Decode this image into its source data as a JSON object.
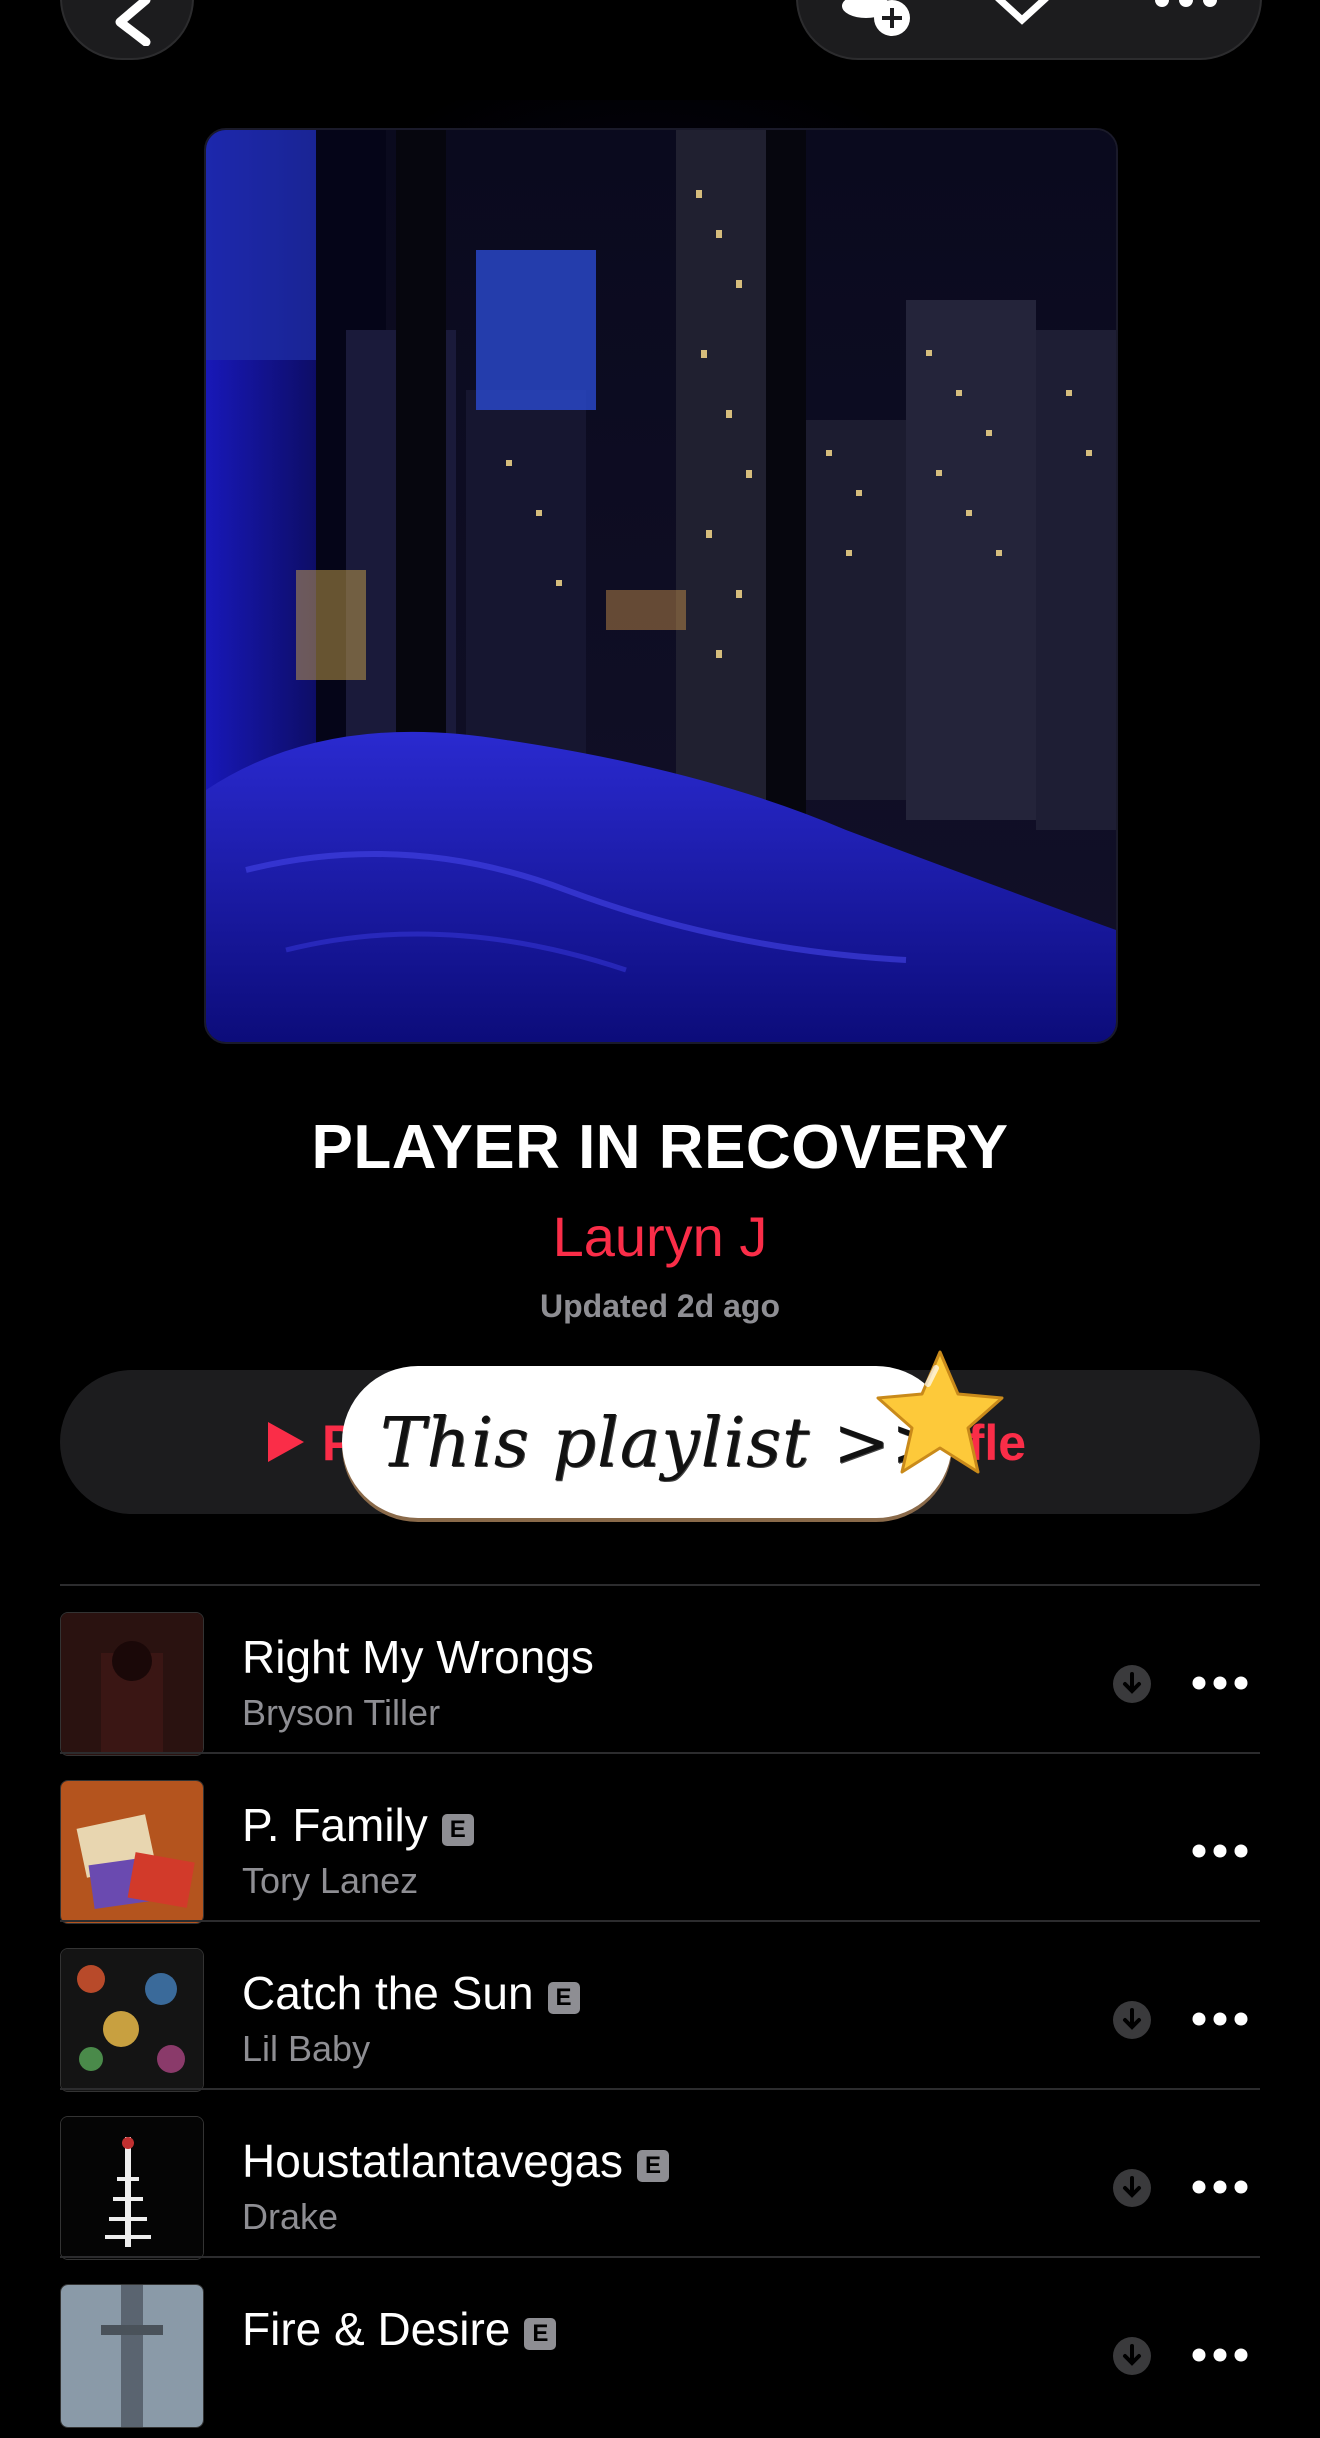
{
  "header": {
    "back_icon": "chevron-left-icon",
    "actions": [
      "add-person-icon",
      "download-icon",
      "more-icon"
    ]
  },
  "playlist": {
    "title": "PLAYER IN RECOVERY",
    "curator": "Lauryn J",
    "updated": "Updated 2d ago"
  },
  "actions": {
    "play_label": "P",
    "shuffle_label": "huffle"
  },
  "sticker": {
    "text": "This playlist >>",
    "icon": "star-icon"
  },
  "colors": {
    "accent": "#fa2d48",
    "secondary_text": "#8e8e93",
    "background": "#000000",
    "surface": "#1c1c1e"
  },
  "songs": [
    {
      "title": "Right My Wrongs",
      "artist": "Bryson Tiller",
      "explicit": false,
      "downloadable": true
    },
    {
      "title": "P. Family",
      "artist": "Tory Lanez",
      "explicit": true,
      "explicit_label": "E",
      "downloadable": false
    },
    {
      "title": "Catch the Sun",
      "artist": "Lil Baby",
      "explicit": true,
      "explicit_label": "E",
      "downloadable": true
    },
    {
      "title": "Houstatlantavegas",
      "artist": "Drake",
      "explicit": true,
      "explicit_label": "E",
      "downloadable": true
    },
    {
      "title": "Fire & Desire",
      "artist": "",
      "explicit": true,
      "explicit_label": "E",
      "downloadable": true
    }
  ]
}
